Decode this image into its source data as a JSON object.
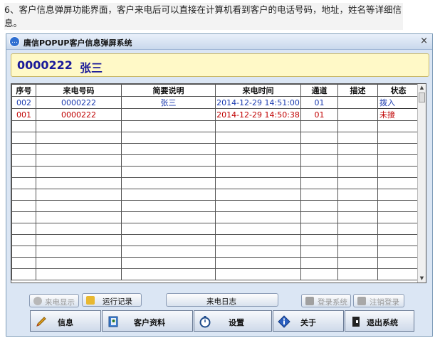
{
  "caption": "6、客户信息弹屏功能界面，客户来电后可以直接在计算机看到客户的电话号码，地址，姓名等详细信息。",
  "window": {
    "title": "唐信POPUP客户信息弹屏系统",
    "close_glyph": "×"
  },
  "caller": {
    "number": "0000222",
    "name": "张三"
  },
  "table": {
    "headers": [
      "序号",
      "来电号码",
      "简要说明",
      "来电时间",
      "通道",
      "描述",
      "状态"
    ],
    "rows": [
      {
        "seq": "002",
        "phone": "0000222",
        "summary": "张三",
        "time": "2014-12-29 14:51:00",
        "channel": "01",
        "desc": "",
        "status": "拨入"
      },
      {
        "seq": "001",
        "phone": "0000222",
        "summary": "",
        "time": "2014-12-29 14:50:38",
        "channel": "01",
        "desc": "",
        "status": "未接"
      }
    ]
  },
  "buttons": {
    "caller_display": "来电显示",
    "run_log": "运行记录",
    "call_log": "来电日志",
    "login": "登录系统",
    "logout": "注销登录"
  },
  "nav": {
    "info": "信息",
    "customer": "客户资料",
    "settings": "设置",
    "about": "关于",
    "exit": "退出系统"
  },
  "colors": {
    "caller_bg": "#fff9c7",
    "row_blue": "#1b3bb0",
    "row_red": "#c00000"
  }
}
